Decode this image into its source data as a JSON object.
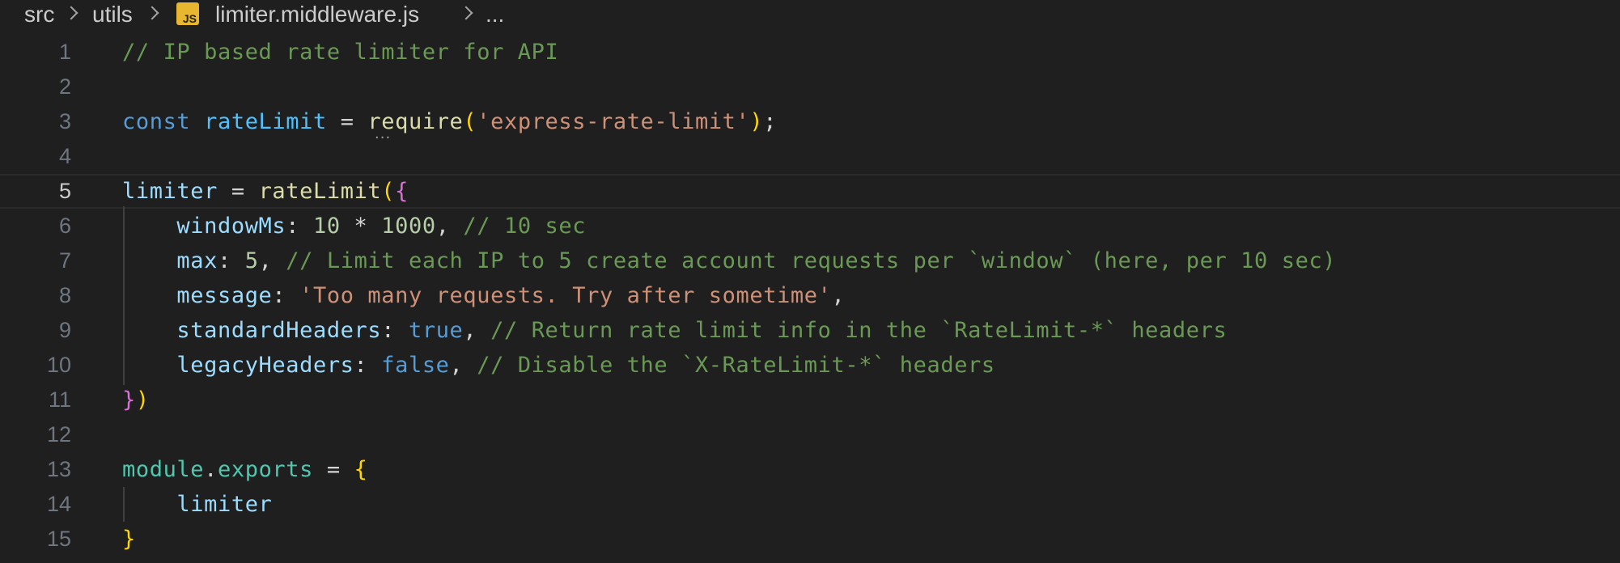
{
  "breadcrumb": {
    "segments": [
      "src",
      "utils",
      "limiter.middleware.js",
      "..."
    ],
    "file_icon": "JS"
  },
  "editor": {
    "current_line": 5,
    "lines": [
      {
        "n": "1",
        "tokens": [
          {
            "t": "// IP based rate limiter for API",
            "c": "comment"
          }
        ]
      },
      {
        "n": "2",
        "tokens": []
      },
      {
        "n": "3",
        "tokens": [
          {
            "t": "const",
            "c": "keyword"
          },
          {
            "t": " ",
            "c": "punc"
          },
          {
            "t": "rateLimit",
            "c": "const"
          },
          {
            "t": " = ",
            "c": "punc"
          },
          {
            "t": "require",
            "c": "fn"
          },
          {
            "t": "(",
            "c": "brace1"
          },
          {
            "t": "'express-rate-limit'",
            "c": "str"
          },
          {
            "t": ")",
            "c": "brace1"
          },
          {
            "t": ";",
            "c": "punc"
          }
        ]
      },
      {
        "n": "4",
        "tokens": []
      },
      {
        "n": "5",
        "tokens": [
          {
            "t": "limiter",
            "c": "var"
          },
          {
            "t": " = ",
            "c": "punc"
          },
          {
            "t": "rateLimit",
            "c": "fn"
          },
          {
            "t": "(",
            "c": "brace1"
          },
          {
            "t": "{",
            "c": "brace2"
          }
        ]
      },
      {
        "n": "6",
        "tokens": [
          {
            "t": "    ",
            "c": "punc"
          },
          {
            "t": "windowMs",
            "c": "prop"
          },
          {
            "t": ": ",
            "c": "punc"
          },
          {
            "t": "10",
            "c": "num"
          },
          {
            "t": " * ",
            "c": "punc"
          },
          {
            "t": "1000",
            "c": "num"
          },
          {
            "t": ", ",
            "c": "punc"
          },
          {
            "t": "// 10 sec",
            "c": "comment"
          }
        ]
      },
      {
        "n": "7",
        "tokens": [
          {
            "t": "    ",
            "c": "punc"
          },
          {
            "t": "max",
            "c": "prop"
          },
          {
            "t": ": ",
            "c": "punc"
          },
          {
            "t": "5",
            "c": "num"
          },
          {
            "t": ", ",
            "c": "punc"
          },
          {
            "t": "// Limit each IP to 5 create account requests per `window` (here, per 10 sec)",
            "c": "comment"
          }
        ]
      },
      {
        "n": "8",
        "tokens": [
          {
            "t": "    ",
            "c": "punc"
          },
          {
            "t": "message",
            "c": "prop"
          },
          {
            "t": ": ",
            "c": "punc"
          },
          {
            "t": "'Too many requests. Try after sometime'",
            "c": "str"
          },
          {
            "t": ",",
            "c": "punc"
          }
        ]
      },
      {
        "n": "9",
        "tokens": [
          {
            "t": "    ",
            "c": "punc"
          },
          {
            "t": "standardHeaders",
            "c": "prop"
          },
          {
            "t": ": ",
            "c": "punc"
          },
          {
            "t": "true",
            "c": "keyword"
          },
          {
            "t": ", ",
            "c": "punc"
          },
          {
            "t": "// Return rate limit info in the `RateLimit-*` headers",
            "c": "comment"
          }
        ]
      },
      {
        "n": "10",
        "tokens": [
          {
            "t": "    ",
            "c": "punc"
          },
          {
            "t": "legacyHeaders",
            "c": "prop"
          },
          {
            "t": ": ",
            "c": "punc"
          },
          {
            "t": "false",
            "c": "keyword"
          },
          {
            "t": ", ",
            "c": "punc"
          },
          {
            "t": "// Disable the `X-RateLimit-*` headers",
            "c": "comment"
          }
        ]
      },
      {
        "n": "11",
        "tokens": [
          {
            "t": "}",
            "c": "brace2"
          },
          {
            "t": ")",
            "c": "brace1"
          }
        ]
      },
      {
        "n": "12",
        "tokens": []
      },
      {
        "n": "13",
        "tokens": [
          {
            "t": "module",
            "c": "module"
          },
          {
            "t": ".",
            "c": "punc"
          },
          {
            "t": "exports",
            "c": "module"
          },
          {
            "t": " = ",
            "c": "punc"
          },
          {
            "t": "{",
            "c": "brace1"
          }
        ]
      },
      {
        "n": "14",
        "tokens": [
          {
            "t": "    ",
            "c": "punc"
          },
          {
            "t": "limiter",
            "c": "var"
          }
        ]
      },
      {
        "n": "15",
        "tokens": [
          {
            "t": "}",
            "c": "brace1"
          }
        ]
      }
    ]
  },
  "colors": {
    "background": "#1f1f1f",
    "comment": "#6a9955",
    "keyword": "#569cd6",
    "string": "#ce9178",
    "function": "#dcdcaa",
    "variable": "#9cdcfe",
    "number": "#b5cea8",
    "bracket_gold": "#ffd700",
    "bracket_purple": "#da70d6"
  },
  "icons": {
    "separator": "chevron-right-icon",
    "file": "javascript-file-icon",
    "hint": "ellipsis-icon"
  }
}
